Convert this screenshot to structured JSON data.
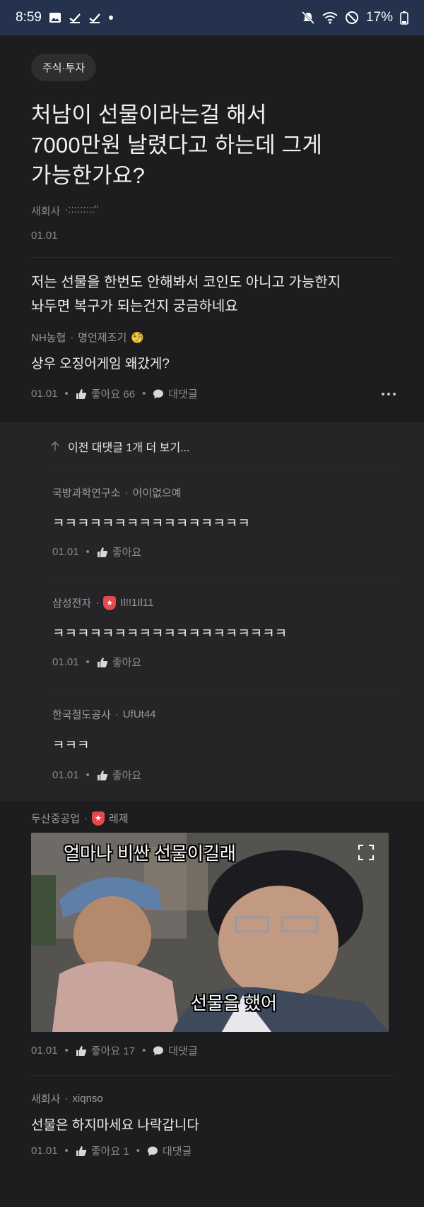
{
  "status_bar": {
    "time": "8:59",
    "battery": "17%"
  },
  "post": {
    "category": "주식·투자",
    "title_lines": [
      "처남이 선물이라는걸 해서",
      "7000만원 날렸다고 하는데 그게",
      "가능한가요?"
    ],
    "author_company": "새회사",
    "author_name": "·:::::::::\"",
    "date": "01.01",
    "body_lines": [
      "저는 선물을 한번도 안해봐서 코인도 아니고 가능한지",
      "놔두면 복구가 되는건지 궁금하네요"
    ]
  },
  "comments": {
    "c1": {
      "company": "NH농협",
      "name": "명언제조기",
      "emoji": "🧐",
      "text": "상우 오징어게임 왜갔게?",
      "date": "01.01",
      "likes": "좋아요 66",
      "reply_label": "대댓글"
    },
    "prev_replies": "이전 대댓글 1개 더 보기...",
    "r1": {
      "company": "국방과학연구소",
      "name": "어이없으예",
      "text": "ㅋㅋㅋㅋㅋㅋㅋㅋㅋㅋㅋㅋㅋㅋㅋㅋ",
      "date": "01.01",
      "likes": "좋아요"
    },
    "r2": {
      "company": "삼성전자",
      "name": "Il!!1Il11",
      "text": "ㅋㅋㅋㅋㅋㅋㅋㅋㅋㅋㅋㅋㅋㅋㅋㅋㅋㅋㅋ",
      "date": "01.01",
      "likes": "좋아요"
    },
    "r3": {
      "company": "한국철도공사",
      "name": "UfUt44",
      "text": "ㅋㅋㅋ",
      "date": "01.01",
      "likes": "좋아요"
    },
    "c2": {
      "company": "두산중공업",
      "name": "레제",
      "meme_top": "얼마나 비싼 선물이길래",
      "meme_bottom": "선물을 했어",
      "date": "01.01",
      "likes": "좋아요 17",
      "reply_label": "대댓글"
    },
    "c3": {
      "company": "새회사",
      "name": "xiqnso",
      "text": "선물은 하지마세요 나락갑니다",
      "date": "01.01",
      "likes": "좋아요 1",
      "reply_label": "대댓글"
    }
  },
  "colors": {
    "background": "#1d1d1f",
    "status_bar": "#24324e",
    "reply_bg": "#252527",
    "badge_red": "#e5484d"
  }
}
